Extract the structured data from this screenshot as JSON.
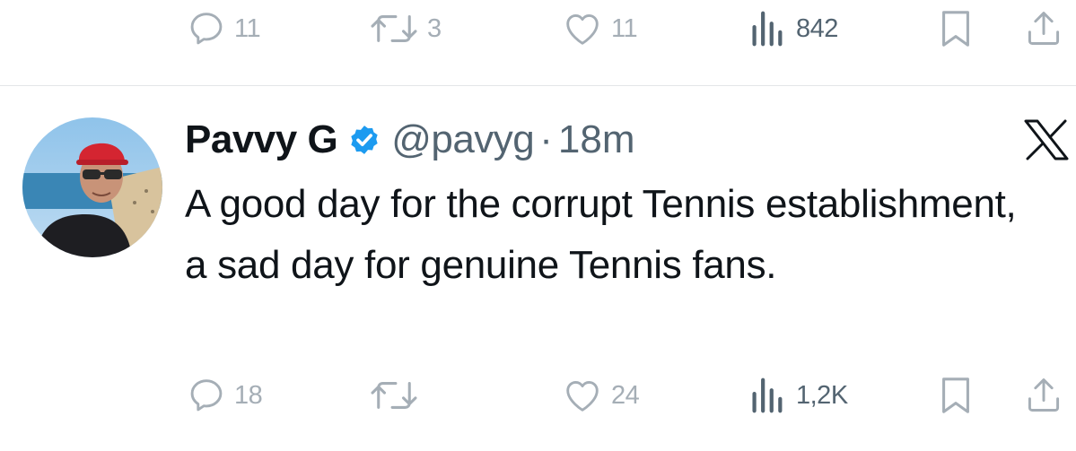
{
  "top_tweet": {
    "replies": "11",
    "retweets": "3",
    "likes": "11",
    "views": "842"
  },
  "tweet": {
    "author_name": "Pavvy G",
    "handle": "@pavyg",
    "separator": "·",
    "time": "18m",
    "verified": true,
    "text": "A good day for the corrupt Tennis establishment, a sad day for genuine Tennis fans.",
    "replies": "18",
    "retweets": "",
    "likes": "24",
    "views": "1,2K"
  },
  "icons": {
    "reply": "reply-icon",
    "retweet": "retweet-icon",
    "like": "heart-icon",
    "views": "views-icon",
    "bookmark": "bookmark-icon",
    "share": "share-icon",
    "platform": "x-logo-icon",
    "verified": "verified-badge-icon"
  },
  "colors": {
    "verified_blue": "#1d9bf0",
    "muted_icon": "#a5aeb6",
    "secondary_text": "#536471",
    "primary_text": "#0f1419"
  }
}
